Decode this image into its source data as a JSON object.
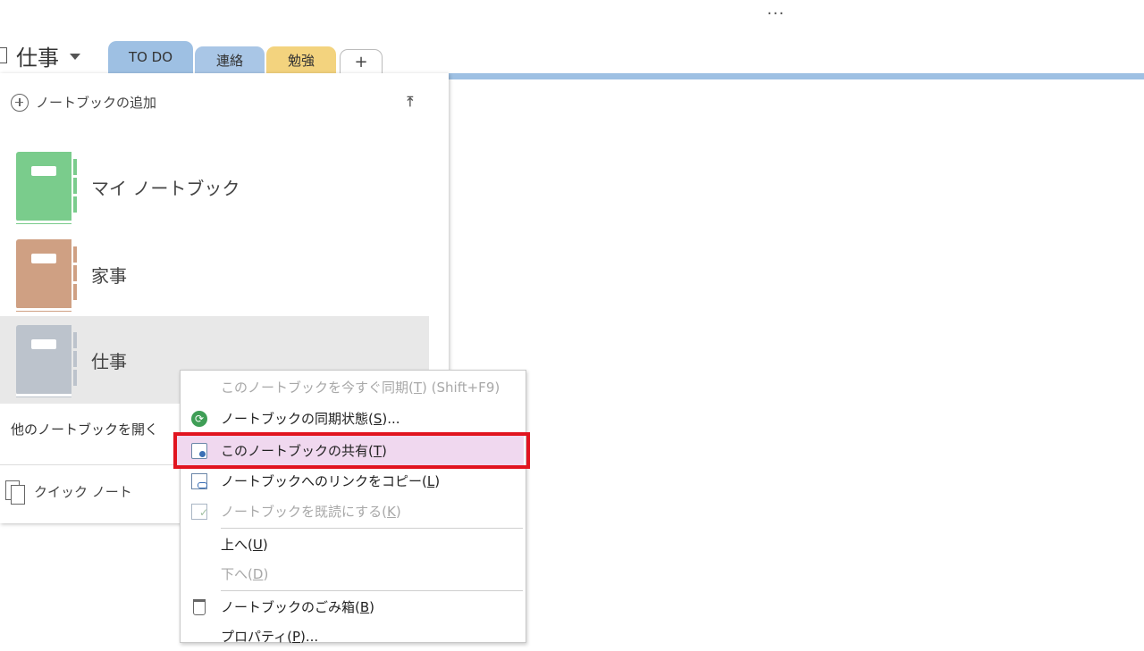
{
  "window": {
    "overflow_glyph": "..."
  },
  "header": {
    "notebook_title": "仕事",
    "tabs": [
      {
        "label": "TO DO",
        "color": "#9ec0e3"
      },
      {
        "label": "連絡",
        "color": "#a9c6e6"
      },
      {
        "label": "勉強",
        "color": "#f3d37e"
      },
      {
        "label": "+"
      }
    ]
  },
  "notebook_panel": {
    "add_label": "ノートブックの追加",
    "notebooks": [
      {
        "label": "マイ ノートブック",
        "color": "#7acc8c"
      },
      {
        "label": "家事",
        "color": "#cfa083"
      },
      {
        "label": "仕事",
        "color": "#bcc3cc",
        "selected": true
      }
    ],
    "open_other": "他のノートブックを開く",
    "quick_notes": "クイック ノート"
  },
  "context_menu": {
    "items": [
      {
        "label": "このノートブックを今すぐ同期",
        "key": "T",
        "suffix": "(Shift+F9)",
        "disabled": true
      },
      {
        "label": "ノートブックの同期状態",
        "key": "S",
        "suffix": "...",
        "icon": "sync-icon"
      },
      {
        "label": "このノートブックの共有",
        "key": "T",
        "suffix": "",
        "icon": "share-notebook-icon",
        "highlighted": true
      },
      {
        "label": "ノートブックへのリンクをコピー",
        "key": "L",
        "suffix": "",
        "icon": "copy-link-icon"
      },
      {
        "label": "ノートブックを既読にする",
        "key": "K",
        "suffix": "",
        "icon": "mark-read-icon",
        "disabled": true
      },
      {
        "label": "上へ",
        "key": "U",
        "suffix": ""
      },
      {
        "label": "下へ",
        "key": "D",
        "suffix": "",
        "disabled": true
      },
      {
        "label": "ノートブックのごみ箱",
        "key": "B",
        "suffix": "",
        "icon": "trash-icon"
      },
      {
        "label": "プロパティ",
        "key": "P",
        "suffix": "..."
      }
    ],
    "highlight_color": "#e1141f"
  }
}
